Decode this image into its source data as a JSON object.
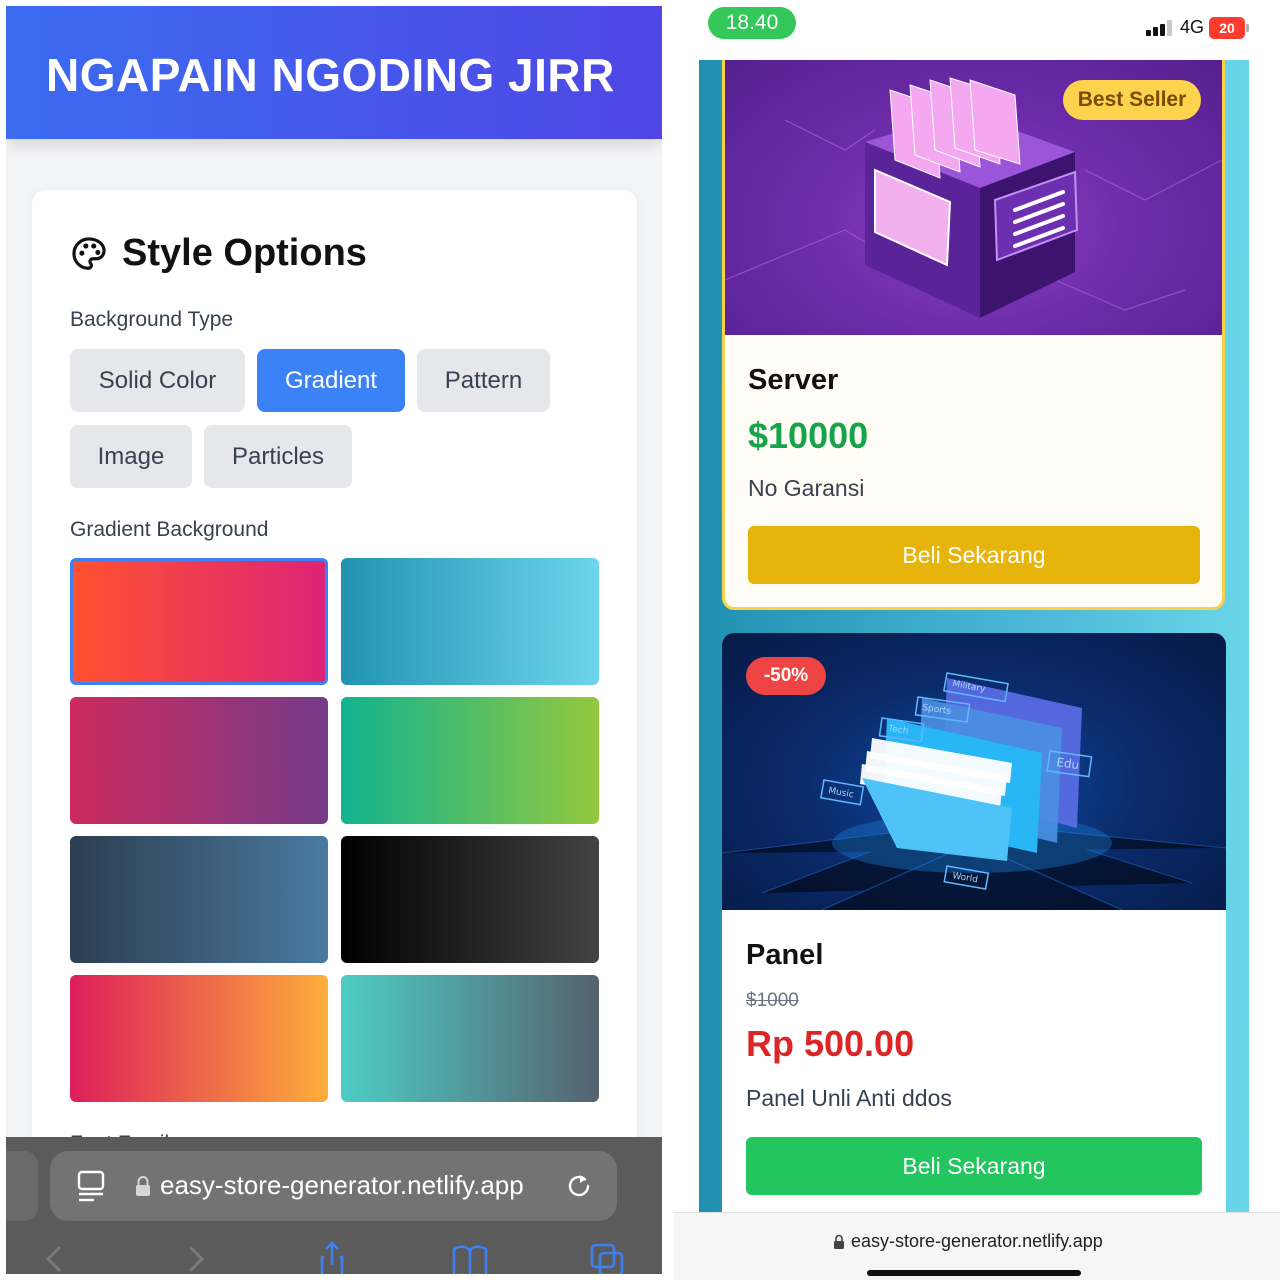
{
  "left_screen": {
    "header_title": "NGAPAIN NGODING JIRR",
    "section_title": "Style Options",
    "background_type_label": "Background Type",
    "background_types": [
      {
        "label": "Solid Color",
        "active": false
      },
      {
        "label": "Gradient",
        "active": true
      },
      {
        "label": "Pattern",
        "active": false
      },
      {
        "label": "Image",
        "active": false
      },
      {
        "label": "Particles",
        "active": false
      }
    ],
    "gradient_label": "Gradient Background",
    "gradient_swatches": [
      {
        "from": "#ff512f",
        "to": "#dd2476",
        "selected": true
      },
      {
        "from": "#2193b0",
        "to": "#6dd5ed",
        "selected": false
      },
      {
        "from": "#cc2b5e",
        "to": "#753a88",
        "selected": false
      },
      {
        "from": "#11b38f",
        "to": "#93c83e",
        "selected": false
      },
      {
        "from": "#2c3e50",
        "to": "#4a7aa0",
        "selected": false
      },
      {
        "from": "#000000",
        "to": "#434343",
        "selected": false
      },
      {
        "from": "#dd1e5a",
        "to": "#fdae3b",
        "selected": false
      },
      {
        "from": "#4ecdc4",
        "to": "#556270",
        "selected": false
      }
    ],
    "font_family_peek": "Font Famil...",
    "browser_url": "easy-store-generator.netlify.app"
  },
  "right_screen": {
    "status_time": "18.40",
    "network": "4G",
    "battery": "20",
    "products": [
      {
        "badge": "Best Seller",
        "name": "Server",
        "price": "$10000",
        "description": "No Garansi",
        "button": "Beli Sekarang",
        "image_labels": []
      },
      {
        "badge": "-50%",
        "name": "Panel",
        "old_price": "$1000",
        "price": "Rp 500.00",
        "description": "Panel Unli Anti ddos",
        "button": "Beli Sekarang",
        "image_labels": [
          "Military",
          "Sports",
          "Tech",
          "Edu",
          "Music",
          "World"
        ]
      }
    ],
    "browser_url": "easy-store-generator.netlify.app"
  },
  "colors": {
    "header_gradient_start": "#3b6cf0",
    "header_gradient_end": "#4f46e5",
    "active_button": "#3b82f6",
    "price_green": "#16a34a",
    "price_red": "#dc2626",
    "buy_yellow": "#e7b40b",
    "buy_green": "#22c55e",
    "status_time_pill": "#34c759"
  },
  "icons": [
    "palette-icon",
    "reader-icon",
    "lock-icon",
    "reload-icon",
    "back-icon",
    "forward-icon",
    "share-icon",
    "bookmarks-icon",
    "tabs-icon",
    "signal-icon",
    "battery-icon"
  ]
}
